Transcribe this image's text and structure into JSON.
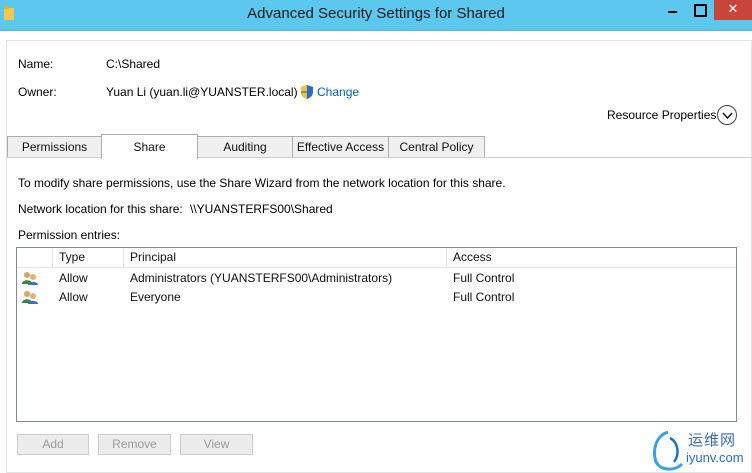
{
  "window": {
    "title": "Advanced Security Settings for Shared",
    "controls": {
      "close": "✕"
    }
  },
  "info": {
    "name_label": "Name:",
    "name_value": "C:\\Shared",
    "owner_label": "Owner:",
    "owner_value": "Yuan Li (yuan.li@YUANSTER.local)",
    "change_link": "Change",
    "resource_properties": "Resource Properties"
  },
  "tabs": [
    {
      "label": "Permissions",
      "active": false
    },
    {
      "label": "Share",
      "active": true
    },
    {
      "label": "Auditing",
      "active": false
    },
    {
      "label": "Effective Access",
      "active": false
    },
    {
      "label": "Central Policy",
      "active": false
    }
  ],
  "share": {
    "instruction": "To modify share permissions, use the Share Wizard from the network location for this share.",
    "network_label": "Network location for this share:",
    "network_value": "\\\\YUANSTERFS00\\Shared",
    "entries_label": "Permission entries:"
  },
  "table": {
    "columns": [
      "Type",
      "Principal",
      "Access"
    ],
    "rows": [
      {
        "type": "Allow",
        "principal": "Administrators (YUANSTERFS00\\Administrators)",
        "access": "Full Control"
      },
      {
        "type": "Allow",
        "principal": "Everyone",
        "access": "Full Control"
      }
    ]
  },
  "buttons": {
    "add": "Add",
    "remove": "Remove",
    "view": "View"
  },
  "watermark": {
    "line1": "运维网",
    "line2": "iyunv.com"
  }
}
